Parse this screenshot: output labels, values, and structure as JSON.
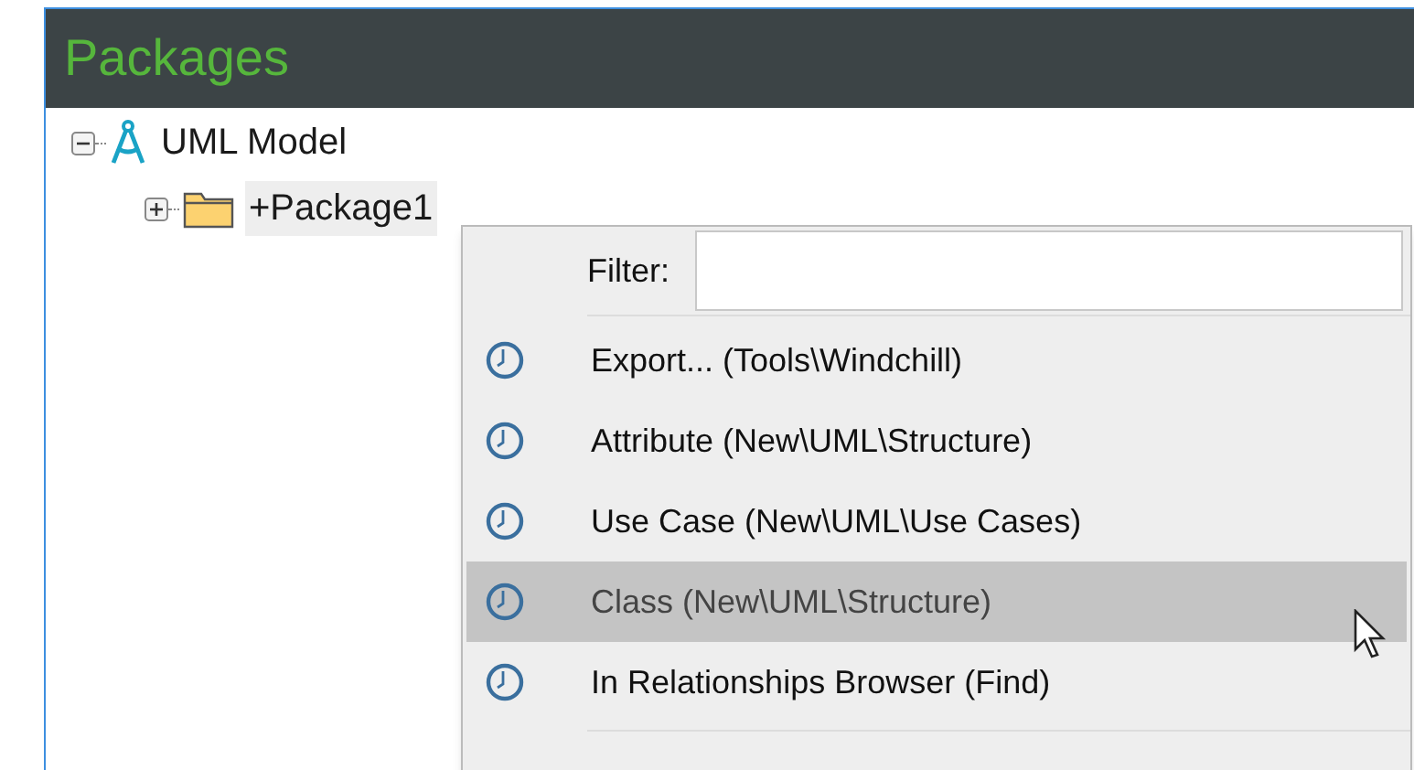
{
  "panel": {
    "title": "Packages"
  },
  "tree": [
    {
      "label": "UML Model",
      "kind": "model",
      "expanded": true,
      "selected": false,
      "children": [
        {
          "label": "+Package1",
          "kind": "package",
          "expanded": false,
          "selected": true
        }
      ]
    }
  ],
  "menu": {
    "filter": {
      "label": "Filter:"
    },
    "items": [
      {
        "label": "Export... (Tools\\Windchill)",
        "selected": false
      },
      {
        "label": "Attribute (New\\UML\\Structure)",
        "selected": false
      },
      {
        "label": "Use Case (New\\UML\\Use Cases)",
        "selected": false
      },
      {
        "label": "Class (New\\UML\\Structure)",
        "selected": true
      },
      {
        "label": "In Relationships Browser (Find)",
        "selected": false
      }
    ]
  }
}
